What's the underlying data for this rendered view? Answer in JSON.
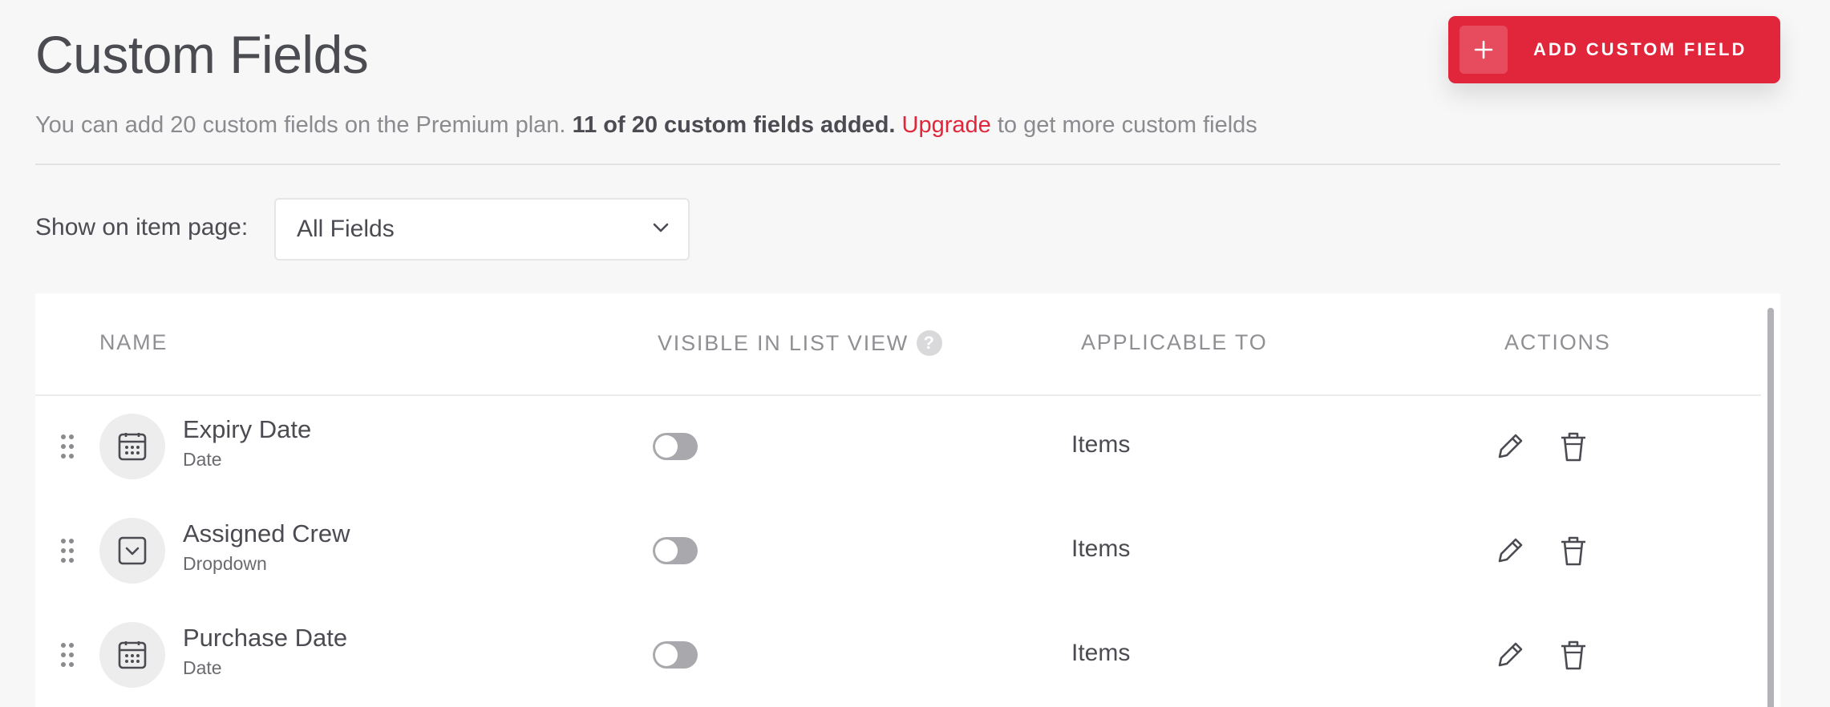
{
  "header": {
    "title": "Custom Fields",
    "add_button_label": "ADD CUSTOM FIELD",
    "add_button_icon": "plus-icon"
  },
  "info": {
    "text_before": "You can add 20 custom fields on the Premium plan. ",
    "strong": "11 of 20 custom fields added.",
    "link": "Upgrade",
    "text_after": " to get more custom fields"
  },
  "filter": {
    "label": "Show on item page:",
    "selected": "All Fields",
    "icon": "chevron-down-icon"
  },
  "table": {
    "columns": {
      "name": "NAME",
      "visible": "VISIBLE IN LIST VIEW",
      "help": "?",
      "applicable": "APPLICABLE TO",
      "actions": "ACTIONS"
    },
    "rows": [
      {
        "name": "Expiry Date",
        "type": "Date",
        "icon": "calendar-icon",
        "visible_in_list": false,
        "applicable_to": "Items"
      },
      {
        "name": "Assigned Crew",
        "type": "Dropdown",
        "icon": "dropdown-icon",
        "visible_in_list": false,
        "applicable_to": "Items"
      },
      {
        "name": "Purchase Date",
        "type": "Date",
        "icon": "calendar-icon",
        "visible_in_list": false,
        "applicable_to": "Items"
      }
    ]
  },
  "colors": {
    "accent": "#e1253a",
    "toggle_off": "#a9a9ad",
    "background": "#f7f7f7"
  }
}
